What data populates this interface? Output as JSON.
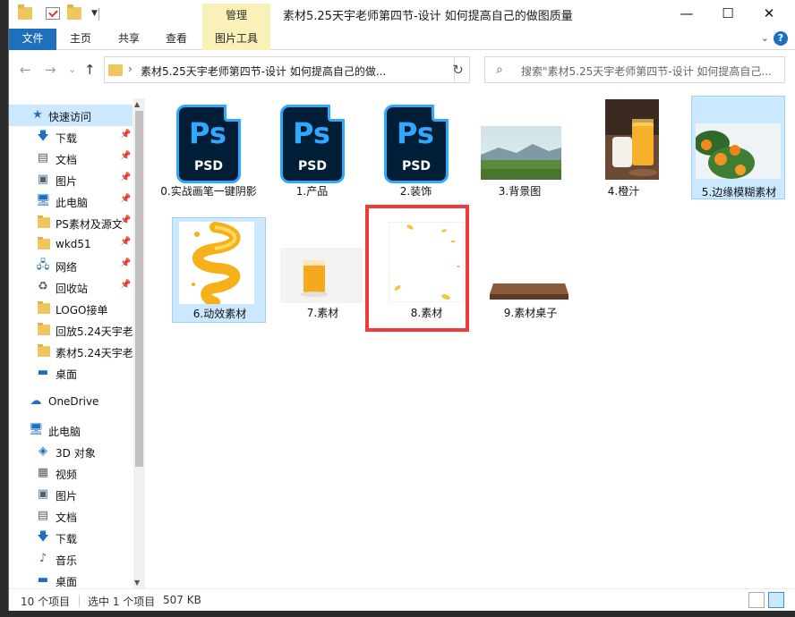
{
  "titlebar": {
    "title": "素材5.25天宇老师第四节-设计 如何提高自己的做图质量",
    "manage_tab": "管理",
    "minimize": "—",
    "maximize": "☐",
    "close": "✕"
  },
  "ribbon": {
    "tabs": [
      "文件",
      "主页",
      "共享",
      "查看",
      "图片工具"
    ],
    "expand": "⌄",
    "help": "?"
  },
  "nav": {
    "back": "←",
    "forward": "→",
    "recent": "⌄",
    "up": "↑",
    "path_separator": "›",
    "address": "素材5.25天宇老师第四节-设计 如何提高自己的做...",
    "address_dropdown": "⌄",
    "refresh": "↻",
    "search_placeholder": "搜索\"素材5.25天宇老师第四节-设计 如何提高自己...",
    "search_icon": "⌕"
  },
  "sidebar": {
    "quick_access": "快速访问",
    "items": [
      {
        "label": "下载",
        "icon": "download-icon",
        "pinned": true
      },
      {
        "label": "文档",
        "icon": "document-icon",
        "pinned": true
      },
      {
        "label": "图片",
        "icon": "picture-icon",
        "pinned": true
      },
      {
        "label": "此电脑",
        "icon": "computer-icon",
        "pinned": true
      },
      {
        "label": "PS素材及源文",
        "icon": "folder-icon",
        "pinned": true
      },
      {
        "label": "wkd51",
        "icon": "folder-icon",
        "pinned": true
      },
      {
        "label": "网络",
        "icon": "network-icon",
        "pinned": true
      },
      {
        "label": "回收站",
        "icon": "recycle-bin-icon",
        "pinned": true
      },
      {
        "label": "LOGO接单",
        "icon": "folder-icon",
        "pinned": false
      },
      {
        "label": "回放5.24天宇老!",
        "icon": "folder-icon",
        "pinned": false
      },
      {
        "label": "素材5.24天宇老!",
        "icon": "folder-icon",
        "pinned": false
      },
      {
        "label": "桌面",
        "icon": "desktop-icon",
        "pinned": false
      }
    ],
    "onedrive": "OneDrive",
    "this_pc": "此电脑",
    "pc_items": [
      {
        "label": "3D 对象",
        "icon": "3d-objects-icon"
      },
      {
        "label": "视频",
        "icon": "video-icon"
      },
      {
        "label": "图片",
        "icon": "picture-icon"
      },
      {
        "label": "文档",
        "icon": "document-icon"
      },
      {
        "label": "下载",
        "icon": "download-icon"
      },
      {
        "label": "音乐",
        "icon": "music-icon"
      },
      {
        "label": "桌面",
        "icon": "desktop-icon"
      }
    ],
    "pin_glyph": "📌",
    "scroll_up": "▲",
    "scroll_down": "▼"
  },
  "files": [
    {
      "name": "0.实战画笔一键阴影",
      "type": "psd"
    },
    {
      "name": "1.产品",
      "type": "psd"
    },
    {
      "name": "2.装饰",
      "type": "psd"
    },
    {
      "name": "3.背景图",
      "type": "image"
    },
    {
      "name": "4.橙汁",
      "type": "image"
    },
    {
      "name": "5.边缘模糊素材",
      "type": "image"
    },
    {
      "name": "6.动效素材",
      "type": "image"
    },
    {
      "name": "7.素材",
      "type": "image"
    },
    {
      "name": "8.素材",
      "type": "image"
    },
    {
      "name": "9.素材桌子",
      "type": "image"
    }
  ],
  "ps_icon": {
    "ps": "Ps",
    "psd": "PSD"
  },
  "status": {
    "count": "10 个项目",
    "selected": "选中 1 个项目",
    "size": "507 KB"
  },
  "colors": {
    "accent": "#1f6fbf",
    "selection": "#cce8ff",
    "highlight_box": "#ef3b3b",
    "ps_blue": "#31a8ff",
    "ps_dark": "#001e36"
  }
}
